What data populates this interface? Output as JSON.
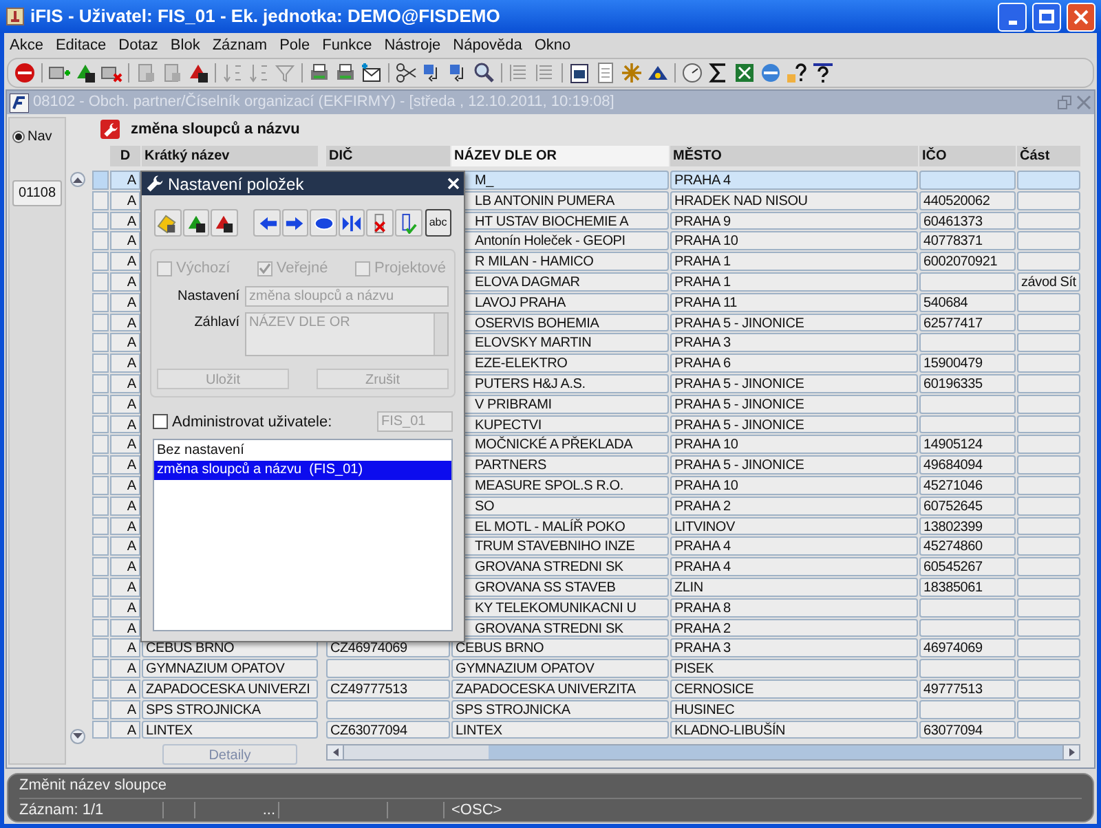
{
  "window": {
    "title": "iFIS - Uživatel: FIS_01 - Ek. jednotka: DEMO@FISDEMO"
  },
  "menu": [
    "Akce",
    "Editace",
    "Dotaz",
    "Blok",
    "Záznam",
    "Pole",
    "Funkce",
    "Nástroje",
    "Nápověda",
    "Okno"
  ],
  "document": {
    "title": "08102 - Obch. partner/Číselník organizací (EKFIRMY) - [středa , 12.10.2011, 10:19:08]"
  },
  "nav": {
    "label": "Nav",
    "selected": true
  },
  "record_field": {
    "value": "01108"
  },
  "heading": "změna sloupců a názvu",
  "table": {
    "columns": [
      "D",
      "Krátký název",
      "DIČ",
      "NÁZEV DLE OR",
      "MĚSTO",
      "IČO",
      "Část"
    ],
    "rows": [
      {
        "selected": true,
        "d": "A",
        "name_or": "M_",
        "city": "PRAHA 4"
      },
      {
        "selected": false,
        "d": "A",
        "name_or": "LB ANTONIN PUMERA",
        "city": "HRADEK NAD NISOU",
        "ico": "440520062"
      },
      {
        "selected": false,
        "d": "A",
        "name_or": "HT USTAV BIOCHEMIE A",
        "city": "PRAHA 9",
        "ico": "60461373"
      },
      {
        "selected": false,
        "d": "A",
        "name_or": "Antonín Holeček - GEOPI",
        "city": "PRAHA 10",
        "ico": "40778371"
      },
      {
        "selected": false,
        "d": "A",
        "name_or": "R MILAN - HAMICO",
        "city": "PRAHA 1",
        "ico": "6002070921"
      },
      {
        "selected": false,
        "d": "A",
        "name_or": "ELOVA DAGMAR",
        "city": "PRAHA 1",
        "part": "závod Sít"
      },
      {
        "selected": false,
        "d": "A",
        "name_or": "LAVOJ PRAHA",
        "city": "PRAHA 11",
        "ico": "540684"
      },
      {
        "selected": false,
        "d": "A",
        "name_or": "OSERVIS BOHEMIA",
        "city": "PRAHA 5 - JINONICE",
        "ico": "62577417"
      },
      {
        "selected": false,
        "d": "A",
        "name_or": "ELOVSKY MARTIN",
        "city": "PRAHA 3"
      },
      {
        "selected": false,
        "d": "A",
        "name_or": "EZE-ELEKTRO",
        "city": "PRAHA 6",
        "ico": "15900479"
      },
      {
        "selected": false,
        "d": "A",
        "name_or": "PUTERS H&J A.S.",
        "city": "PRAHA 5 - JINONICE",
        "ico": "60196335"
      },
      {
        "selected": false,
        "d": "A",
        "name_or": "V PRIBRAMI",
        "city": "PRAHA 5 - JINONICE"
      },
      {
        "selected": false,
        "d": "A",
        "name_or": "KUPECTVI",
        "city": "PRAHA 5 - JINONICE"
      },
      {
        "selected": false,
        "d": "A",
        "name_or": "MOČNICKÉ A PŘEKLADA",
        "city": "PRAHA 10",
        "ico": "14905124"
      },
      {
        "selected": false,
        "d": "A",
        "name_or": "PARTNERS",
        "city": "PRAHA 5 - JINONICE",
        "ico": "49684094"
      },
      {
        "selected": false,
        "d": "A",
        "name_or": "MEASURE SPOL.S R.O.",
        "city": "PRAHA 10",
        "ico": "45271046"
      },
      {
        "selected": false,
        "d": "A",
        "name_or": "SO",
        "city": "PRAHA 2",
        "ico": "60752645"
      },
      {
        "selected": false,
        "d": "A",
        "name_or": "EL MOTL - MALÍŘ POKO",
        "city": "LITVINOV",
        "ico": "13802399"
      },
      {
        "selected": false,
        "d": "A",
        "name_or": "TRUM STAVEBNIHO INZE",
        "city": "PRAHA 4",
        "ico": "45274860"
      },
      {
        "selected": false,
        "d": "A",
        "name_or": "GROVANA STREDNI SK",
        "city": "PRAHA 4",
        "ico": "60545267"
      },
      {
        "selected": false,
        "d": "A",
        "name_or": "GROVANA SS STAVEB",
        "city": "ZLIN",
        "ico": "18385061"
      },
      {
        "selected": false,
        "d": "A",
        "name_or": "KY TELEKOMUNIKACNI U",
        "city": "PRAHA 8"
      },
      {
        "selected": false,
        "d": "A",
        "name_or": "GROVANA STREDNI SK",
        "city": "PRAHA 2"
      },
      {
        "selected": false,
        "d": "A",
        "short_name": "CEBUS BRNO",
        "dic": "CZ46974069",
        "name_or": "CEBUS BRNO",
        "city": "PRAHA 3",
        "ico": "46974069"
      },
      {
        "selected": false,
        "d": "A",
        "short_name": "GYMNAZIUM OPATOV",
        "name_or": "GYMNAZIUM OPATOV",
        "city": "PISEK"
      },
      {
        "selected": false,
        "d": "A",
        "short_name": "ZAPADOCESKA UNIVERZI",
        "dic": "CZ49777513",
        "name_or": "ZAPADOCESKA UNIVERZITA",
        "city": "CERNOSICE",
        "ico": "49777513"
      },
      {
        "selected": false,
        "d": "A",
        "short_name": "SPS STROJNICKA",
        "name_or": "SPS STROJNICKA",
        "city": "HUSINEC"
      },
      {
        "selected": false,
        "d": "A",
        "short_name": "LINTEX",
        "dic": "CZ63077094",
        "name_or": "LINTEX",
        "city": "KLADNO-LIBUŠÍN",
        "ico": "63077094"
      }
    ]
  },
  "detail_button": "Detaily",
  "dialog": {
    "title": "Nastavení položek",
    "tool_label": "abc",
    "options": [
      {
        "label": "Výchozí",
        "checked": false
      },
      {
        "label": "Veřejné",
        "checked": true
      },
      {
        "label": "Projektové",
        "checked": false
      }
    ],
    "setting_label": "Nastavení",
    "setting_value": "změna sloupců a názvu",
    "header_label": "Záhlaví",
    "header_value": "NÁZEV DLE OR",
    "buttons": [
      "Uložit",
      "Zrušit"
    ],
    "admin": {
      "label": "Administrovat uživatele:",
      "checked": false,
      "user": "FIS_01"
    },
    "list": [
      {
        "label": "Bez nastavení",
        "selected": false
      },
      {
        "label": "změna sloupců a názvu  (FIS_01)",
        "selected": true
      }
    ]
  },
  "status": {
    "message": "Změnit název sloupce",
    "record": "Záznam: 1/1",
    "field_2": "...",
    "mode": "<OSC>"
  }
}
